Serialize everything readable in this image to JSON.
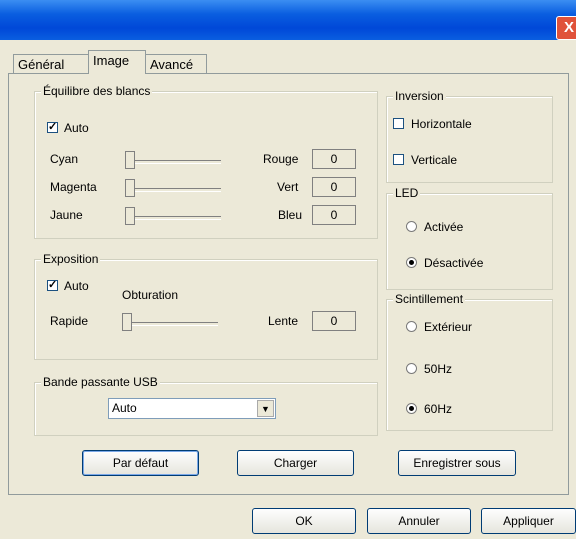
{
  "window": {
    "close_glyph": "X"
  },
  "tabs": [
    {
      "label": "Général"
    },
    {
      "label": "Image"
    },
    {
      "label": "Avancé"
    }
  ],
  "white_balance": {
    "legend": "Équilibre des blancs",
    "auto_label": "Auto",
    "auto_checked": true,
    "sliders": [
      {
        "left_label": "Cyan",
        "right_label": "Rouge",
        "value": "0"
      },
      {
        "left_label": "Magenta",
        "right_label": "Vert",
        "value": "0"
      },
      {
        "left_label": "Jaune",
        "right_label": "Bleu",
        "value": "0"
      }
    ]
  },
  "exposure": {
    "legend": "Exposition",
    "auto_label": "Auto",
    "auto_checked": true,
    "shutter_label": "Obturation",
    "left_label": "Rapide",
    "right_label": "Lente",
    "value": "0"
  },
  "usb": {
    "legend": "Bande passante USB",
    "selected": "Auto"
  },
  "inversion": {
    "legend": "Inversion",
    "horizontal_label": "Horizontale",
    "vertical_label": "Verticale"
  },
  "led": {
    "legend": "LED",
    "on_label": "Activée",
    "off_label": "Désactivée",
    "selected": "Désactivée"
  },
  "flicker": {
    "legend": "Scintillement",
    "outdoor_label": "Extérieur",
    "hz50_label": "50Hz",
    "hz60_label": "60Hz",
    "selected": "60Hz"
  },
  "actions": {
    "default_label": "Par défaut",
    "load_label": "Charger",
    "save_as_label": "Enregistrer sous"
  },
  "footer": {
    "ok_label": "OK",
    "cancel_label": "Annuler",
    "apply_label": "Appliquer"
  }
}
